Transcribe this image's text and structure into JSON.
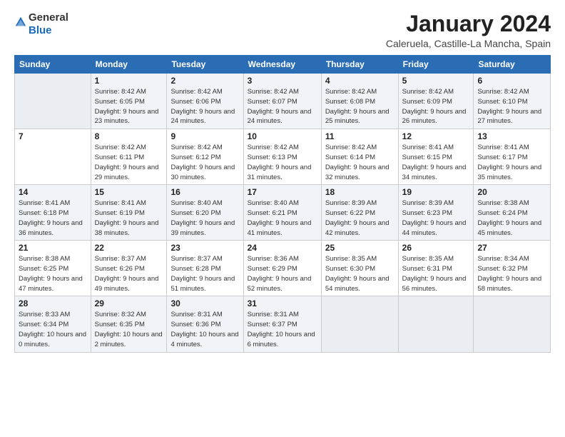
{
  "header": {
    "logo_general": "General",
    "logo_blue": "Blue",
    "month_title": "January 2024",
    "location": "Caleruela, Castille-La Mancha, Spain"
  },
  "days_of_week": [
    "Sunday",
    "Monday",
    "Tuesday",
    "Wednesday",
    "Thursday",
    "Friday",
    "Saturday"
  ],
  "weeks": [
    [
      {
        "num": "",
        "sunrise": "",
        "sunset": "",
        "daylight": ""
      },
      {
        "num": "1",
        "sunrise": "Sunrise: 8:42 AM",
        "sunset": "Sunset: 6:05 PM",
        "daylight": "Daylight: 9 hours and 23 minutes."
      },
      {
        "num": "2",
        "sunrise": "Sunrise: 8:42 AM",
        "sunset": "Sunset: 6:06 PM",
        "daylight": "Daylight: 9 hours and 24 minutes."
      },
      {
        "num": "3",
        "sunrise": "Sunrise: 8:42 AM",
        "sunset": "Sunset: 6:07 PM",
        "daylight": "Daylight: 9 hours and 24 minutes."
      },
      {
        "num": "4",
        "sunrise": "Sunrise: 8:42 AM",
        "sunset": "Sunset: 6:08 PM",
        "daylight": "Daylight: 9 hours and 25 minutes."
      },
      {
        "num": "5",
        "sunrise": "Sunrise: 8:42 AM",
        "sunset": "Sunset: 6:09 PM",
        "daylight": "Daylight: 9 hours and 26 minutes."
      },
      {
        "num": "6",
        "sunrise": "Sunrise: 8:42 AM",
        "sunset": "Sunset: 6:10 PM",
        "daylight": "Daylight: 9 hours and 27 minutes."
      }
    ],
    [
      {
        "num": "7",
        "sunrise": "",
        "sunset": "",
        "daylight": ""
      },
      {
        "num": "8",
        "sunrise": "Sunrise: 8:42 AM",
        "sunset": "Sunset: 6:11 PM",
        "daylight": "Daylight: 9 hours and 29 minutes."
      },
      {
        "num": "9",
        "sunrise": "Sunrise: 8:42 AM",
        "sunset": "Sunset: 6:12 PM",
        "daylight": "Daylight: 9 hours and 30 minutes."
      },
      {
        "num": "10",
        "sunrise": "Sunrise: 8:42 AM",
        "sunset": "Sunset: 6:13 PM",
        "daylight": "Daylight: 9 hours and 31 minutes."
      },
      {
        "num": "11",
        "sunrise": "Sunrise: 8:42 AM",
        "sunset": "Sunset: 6:14 PM",
        "daylight": "Daylight: 9 hours and 32 minutes."
      },
      {
        "num": "12",
        "sunrise": "Sunrise: 8:41 AM",
        "sunset": "Sunset: 6:15 PM",
        "daylight": "Daylight: 9 hours and 34 minutes."
      },
      {
        "num": "13",
        "sunrise": "Sunrise: 8:41 AM",
        "sunset": "Sunset: 6:17 PM",
        "daylight": "Daylight: 9 hours and 35 minutes."
      }
    ],
    [
      {
        "num": "14",
        "sunrise": "Sunrise: 8:41 AM",
        "sunset": "Sunset: 6:18 PM",
        "daylight": "Daylight: 9 hours and 36 minutes."
      },
      {
        "num": "15",
        "sunrise": "Sunrise: 8:41 AM",
        "sunset": "Sunset: 6:19 PM",
        "daylight": "Daylight: 9 hours and 38 minutes."
      },
      {
        "num": "16",
        "sunrise": "Sunrise: 8:40 AM",
        "sunset": "Sunset: 6:20 PM",
        "daylight": "Daylight: 9 hours and 39 minutes."
      },
      {
        "num": "17",
        "sunrise": "Sunrise: 8:40 AM",
        "sunset": "Sunset: 6:21 PM",
        "daylight": "Daylight: 9 hours and 41 minutes."
      },
      {
        "num": "18",
        "sunrise": "Sunrise: 8:39 AM",
        "sunset": "Sunset: 6:22 PM",
        "daylight": "Daylight: 9 hours and 42 minutes."
      },
      {
        "num": "19",
        "sunrise": "Sunrise: 8:39 AM",
        "sunset": "Sunset: 6:23 PM",
        "daylight": "Daylight: 9 hours and 44 minutes."
      },
      {
        "num": "20",
        "sunrise": "Sunrise: 8:38 AM",
        "sunset": "Sunset: 6:24 PM",
        "daylight": "Daylight: 9 hours and 45 minutes."
      }
    ],
    [
      {
        "num": "21",
        "sunrise": "Sunrise: 8:38 AM",
        "sunset": "Sunset: 6:25 PM",
        "daylight": "Daylight: 9 hours and 47 minutes."
      },
      {
        "num": "22",
        "sunrise": "Sunrise: 8:37 AM",
        "sunset": "Sunset: 6:26 PM",
        "daylight": "Daylight: 9 hours and 49 minutes."
      },
      {
        "num": "23",
        "sunrise": "Sunrise: 8:37 AM",
        "sunset": "Sunset: 6:28 PM",
        "daylight": "Daylight: 9 hours and 51 minutes."
      },
      {
        "num": "24",
        "sunrise": "Sunrise: 8:36 AM",
        "sunset": "Sunset: 6:29 PM",
        "daylight": "Daylight: 9 hours and 52 minutes."
      },
      {
        "num": "25",
        "sunrise": "Sunrise: 8:35 AM",
        "sunset": "Sunset: 6:30 PM",
        "daylight": "Daylight: 9 hours and 54 minutes."
      },
      {
        "num": "26",
        "sunrise": "Sunrise: 8:35 AM",
        "sunset": "Sunset: 6:31 PM",
        "daylight": "Daylight: 9 hours and 56 minutes."
      },
      {
        "num": "27",
        "sunrise": "Sunrise: 8:34 AM",
        "sunset": "Sunset: 6:32 PM",
        "daylight": "Daylight: 9 hours and 58 minutes."
      }
    ],
    [
      {
        "num": "28",
        "sunrise": "Sunrise: 8:33 AM",
        "sunset": "Sunset: 6:34 PM",
        "daylight": "Daylight: 10 hours and 0 minutes."
      },
      {
        "num": "29",
        "sunrise": "Sunrise: 8:32 AM",
        "sunset": "Sunset: 6:35 PM",
        "daylight": "Daylight: 10 hours and 2 minutes."
      },
      {
        "num": "30",
        "sunrise": "Sunrise: 8:31 AM",
        "sunset": "Sunset: 6:36 PM",
        "daylight": "Daylight: 10 hours and 4 minutes."
      },
      {
        "num": "31",
        "sunrise": "Sunrise: 8:31 AM",
        "sunset": "Sunset: 6:37 PM",
        "daylight": "Daylight: 10 hours and 6 minutes."
      },
      {
        "num": "",
        "sunrise": "",
        "sunset": "",
        "daylight": ""
      },
      {
        "num": "",
        "sunrise": "",
        "sunset": "",
        "daylight": ""
      },
      {
        "num": "",
        "sunrise": "",
        "sunset": "",
        "daylight": ""
      }
    ]
  ]
}
